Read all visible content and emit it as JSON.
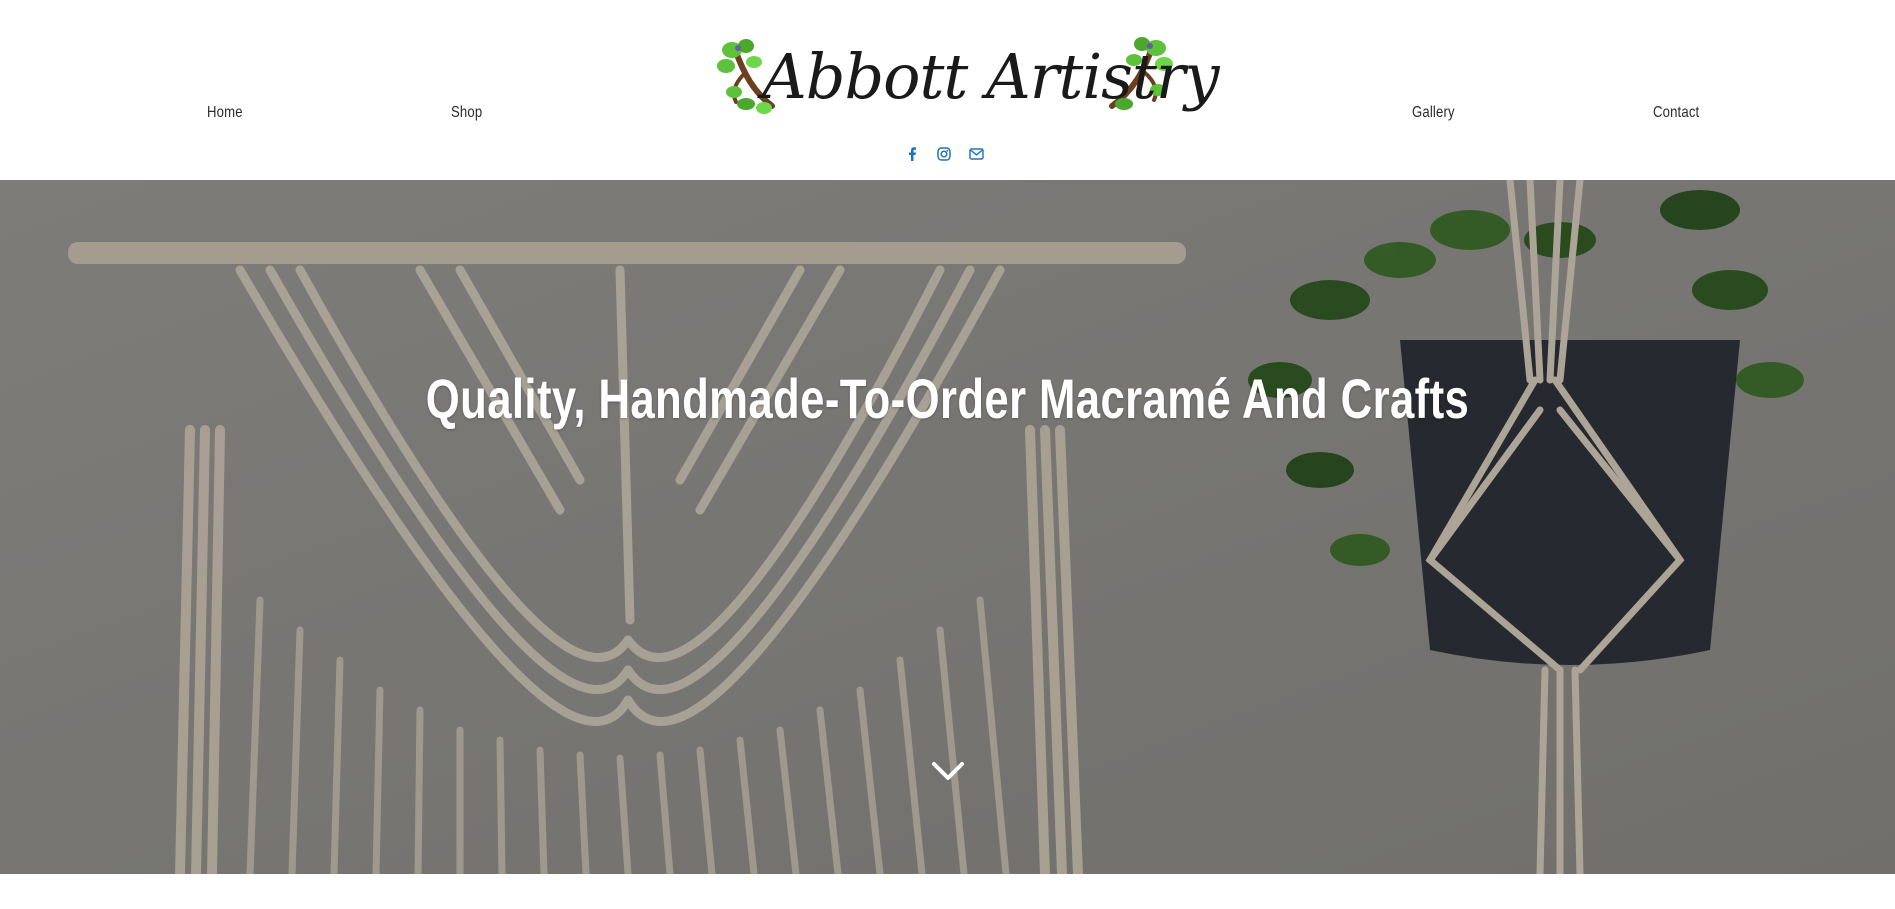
{
  "site": {
    "logo_text": "Abbott Artistry"
  },
  "nav": {
    "home": "Home",
    "shop": "Shop",
    "gallery": "Gallery",
    "contact": "Contact"
  },
  "social": {
    "icons": [
      "facebook-icon",
      "instagram-icon",
      "email-icon"
    ],
    "color": "#1e73be"
  },
  "hero": {
    "title": "Quality, Handmade-To-Order Macramé And Crafts",
    "scroll_icon": "chevron-down-icon"
  },
  "colors": {
    "nav_text": "#2b2b2b",
    "hero_text": "#ffffff",
    "leaf_green": "#5cc23a",
    "branch_brown": "#6b3f1f"
  }
}
